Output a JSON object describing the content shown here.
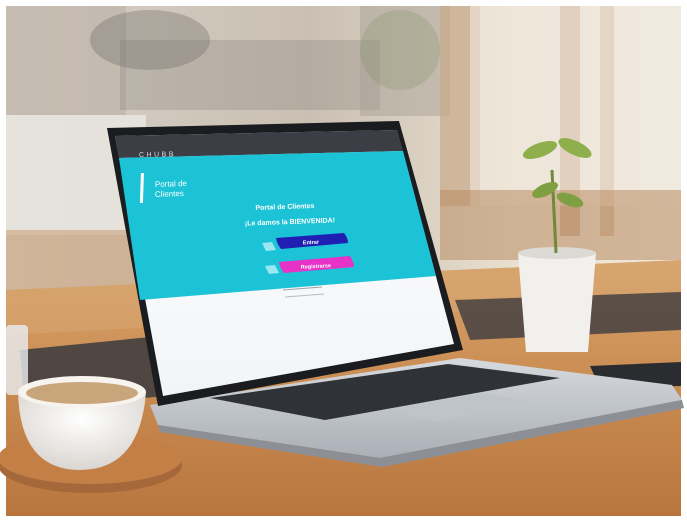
{
  "scene": {
    "description_colors": {
      "screen_cyan": "#1cc3d6",
      "button_entrar": "#1f1fb4",
      "button_registrarse": "#e632c6",
      "topbar": "#3b3e44"
    }
  },
  "laptop_screen": {
    "brand": "CHUBB",
    "portal_title_line1": "Portal de",
    "portal_title_line2": "Clientes",
    "heading": "Portal de Clientes",
    "welcome": "¡Le damos la BIENVENIDA!",
    "login_button": "Entrar",
    "register_button": "Registrarse"
  }
}
